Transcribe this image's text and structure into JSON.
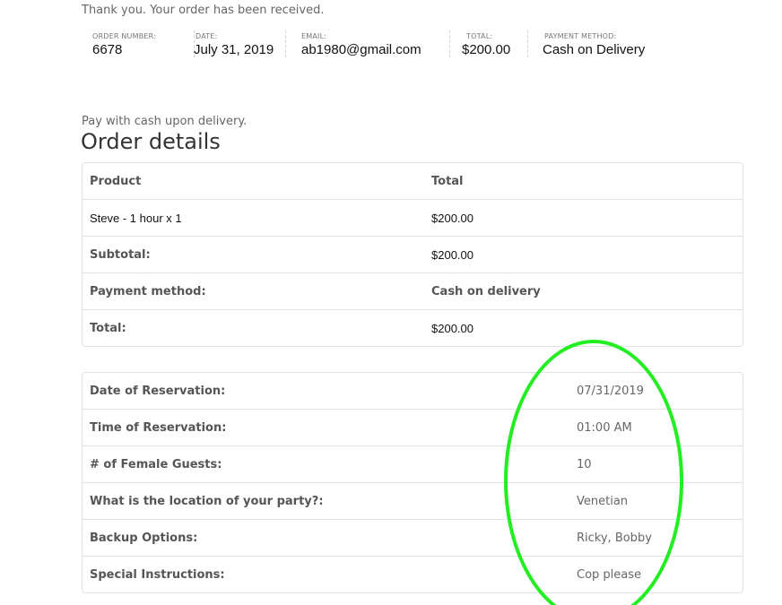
{
  "thanks_message": "Thank you. Your order has been received.",
  "overview": {
    "order_number_label": "ORDER NUMBER:",
    "order_number": "6678",
    "date_label": "DATE:",
    "date": "July 31, 2019",
    "email_label": "EMAIL:",
    "email": "ab1980@gmail.com",
    "total_label": "TOTAL:",
    "total": "$200.00",
    "payment_label": "PAYMENT METHOD:",
    "payment": "Cash on Delivery"
  },
  "pay_note": "Pay with cash upon delivery.",
  "order_details": {
    "title": "Order details",
    "header": {
      "product": "Product",
      "total": "Total"
    },
    "item": {
      "name": "Steve - 1 hour",
      "qty": "x 1",
      "total": "$200.00"
    },
    "subtotal_label": "Subtotal:",
    "subtotal": "$200.00",
    "payment_method_label": "Payment method:",
    "payment_method": "Cash on delivery",
    "total_label": "Total:",
    "total": "$200.00"
  },
  "reservation": [
    {
      "label": "Date of Reservation:",
      "value": "07/31/2019"
    },
    {
      "label": "Time of Reservation:",
      "value": "01:00 AM"
    },
    {
      "label": "# of Female Guests:",
      "value": "10"
    },
    {
      "label": "What is the location of your party?:",
      "value": "Venetian"
    },
    {
      "label": "Backup Options:",
      "value": "Ricky, Bobby"
    },
    {
      "label": "Special Instructions:",
      "value": "Cop please"
    }
  ],
  "colors": {
    "highlight_circle": "#22ee22"
  }
}
